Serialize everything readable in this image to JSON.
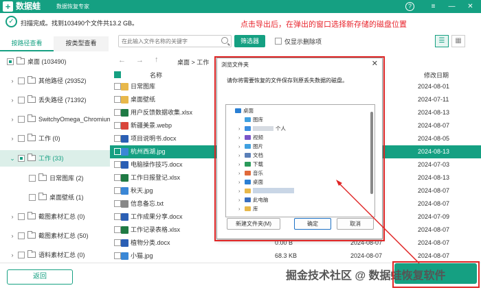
{
  "title_bar": {
    "logo": "+",
    "app_name": "数据蛙",
    "app_subtitle": "数据恢复专家",
    "help": "?",
    "menu": "≡",
    "minimize": "—",
    "close": "✕",
    "brand_color": "#15a082"
  },
  "status": {
    "text": "扫描完成。找到103490个文件共13.2 GB。"
  },
  "annotation": "点击导出后，在弹出的窗口选择新存储的磁盘位置",
  "tabs": {
    "path": "按路径查看",
    "type": "按类型查看"
  },
  "toolbar": {
    "search_placeholder": "在此输入文件名称的关键字",
    "filter": "筛选器",
    "show_deleted": "仅显示删除项",
    "view_list": "☰",
    "view_grid": "▦"
  },
  "tree": [
    {
      "label": "桌面 (103490)",
      "state": "partial"
    },
    {
      "label": "其他路径 (29352)",
      "state": "off"
    },
    {
      "label": "丢失路径 (71392)",
      "state": "off"
    },
    {
      "label": "SwitchyOmega_Chromium",
      "state": "off"
    },
    {
      "label": "工作 (0)",
      "state": "off"
    },
    {
      "label": "工作 (33)",
      "state": "partial"
    },
    {
      "label": "日常图库 (2)",
      "state": "off"
    },
    {
      "label": "桌面壁纸 (1)",
      "state": "off"
    },
    {
      "label": "截图素材汇总 (0)",
      "state": "off"
    },
    {
      "label": "截图素材汇总 (50)",
      "state": "off"
    },
    {
      "label": "语料素材汇总 (0)",
      "state": "off"
    }
  ],
  "back": "返回",
  "nav": {
    "back": "←",
    "forward": "→",
    "up": "↑",
    "breadcrumb": "桌面 > 工作"
  },
  "table": {
    "col_name": "名称",
    "col_modified": "修改日期",
    "rows": [
      {
        "name": "日常图库",
        "size": "",
        "date": "",
        "modified": "2024-08-01",
        "icon": "folder"
      },
      {
        "name": "桌面壁纸",
        "size": "",
        "date": "",
        "modified": "2024-07-11",
        "icon": "folder"
      },
      {
        "name": "用户反馈数据收集.xlsx",
        "size": "",
        "date": "",
        "modified": "2024-08-13",
        "icon": "xlsx"
      },
      {
        "name": "新疆美景.webp",
        "size": "",
        "date": "",
        "modified": "2024-08-07",
        "icon": "webp"
      },
      {
        "name": "项目说明书.docx",
        "size": "",
        "date": "",
        "modified": "2024-08-05",
        "icon": "docx"
      },
      {
        "name": "杭州西湖.jpg",
        "size": "",
        "date": "",
        "modified": "2024-08-13",
        "icon": "jpg"
      },
      {
        "name": "电脑操作技巧.docx",
        "size": "",
        "date": "",
        "modified": "2024-07-03",
        "icon": "docx"
      },
      {
        "name": "工作日报登记.xlsx",
        "size": "",
        "date": "",
        "modified": "2024-08-13",
        "icon": "xlsx"
      },
      {
        "name": "秋天.jpg",
        "size": "",
        "date": "",
        "modified": "2024-08-07",
        "icon": "jpg"
      },
      {
        "name": "信息备忘.txt",
        "size": "",
        "date": "",
        "modified": "2024-08-07",
        "icon": "txt"
      },
      {
        "name": "工作成果分享.docx",
        "size": "",
        "date": "",
        "modified": "2024-07-09",
        "icon": "docx"
      },
      {
        "name": "工作记录表格.xlsx",
        "size": "",
        "date": "",
        "modified": "2024-08-07",
        "icon": "xlsx"
      },
      {
        "name": "植物分类.docx",
        "size": "0.00  B",
        "date": "2024-08-07",
        "modified": "2024-08-07",
        "icon": "docx"
      },
      {
        "name": "小猫.jpg",
        "size": "68.3 KB",
        "date": "2024-08-07",
        "modified": "2024-08-07",
        "icon": "jpg"
      }
    ]
  },
  "dialog": {
    "title": "浏览文件夹",
    "close": "✕",
    "message": "请你将需要恢复的文件保存到原丢失数据的磁盘。",
    "nodes": [
      {
        "label": "桌面",
        "icon": "desktop"
      },
      {
        "label": "图库",
        "icon": "image"
      },
      {
        "label": "个人",
        "icon": "cloud"
      },
      {
        "label": "视频",
        "icon": "video"
      },
      {
        "label": "图片",
        "icon": "image"
      },
      {
        "label": "文档",
        "icon": "doc"
      },
      {
        "label": "下载",
        "icon": "download"
      },
      {
        "label": "音乐",
        "icon": "music"
      },
      {
        "label": "桌面",
        "icon": "desktop"
      },
      {
        "label": "",
        "icon": "folder"
      },
      {
        "label": "此电脑",
        "icon": "pc"
      },
      {
        "label": "库",
        "icon": "folder"
      }
    ],
    "new_folder": "新建文件夹(M)",
    "ok": "确定",
    "cancel": "取消"
  },
  "watermark": "掘金技术社区 @ 数据蛙恢复软件"
}
